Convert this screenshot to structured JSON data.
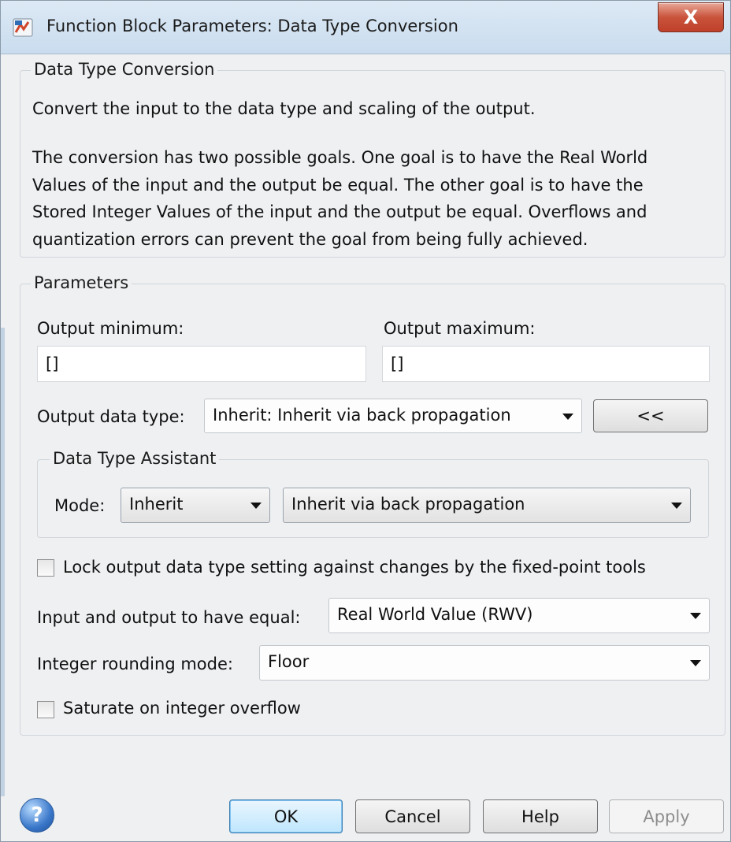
{
  "window": {
    "title": "Function Block Parameters: Data Type Conversion",
    "close_label": "X"
  },
  "description": {
    "group_label": "Data Type Conversion",
    "line1": "Convert the input to the data type and scaling of the output.",
    "para2_line1": "The conversion has two possible goals. One goal is to have the Real World",
    "para2_line2": "Values of the input and the output be equal.  The other goal is to have the",
    "para2_line3": "Stored Integer Values of the input and the output be equal.  Overflows and",
    "para2_line4": "quantization errors can prevent the goal from being fully achieved."
  },
  "parameters": {
    "group_label": "Parameters",
    "output_minimum": {
      "label": "Output minimum:",
      "value": "[]"
    },
    "output_maximum": {
      "label": "Output maximum:",
      "value": "[]"
    },
    "output_data_type": {
      "label": "Output data type:",
      "value": "Inherit: Inherit via back propagation",
      "toggle_label": "<<"
    },
    "assistant": {
      "group_label": "Data Type Assistant",
      "mode_label": "Mode:",
      "mode_value": "Inherit",
      "inherit_value": "Inherit via back propagation"
    },
    "lock_checkbox": {
      "label": "Lock output data type setting against changes by the fixed-point tools",
      "checked": false
    },
    "equal": {
      "label": "Input and output to have equal:",
      "value": "Real World Value (RWV)"
    },
    "rounding": {
      "label": "Integer rounding mode:",
      "value": "Floor"
    },
    "saturate_checkbox": {
      "label": "Saturate on integer overflow",
      "checked": false
    }
  },
  "buttons": {
    "help_icon": "?",
    "ok": "OK",
    "cancel": "Cancel",
    "help": "Help",
    "apply": "Apply"
  },
  "icons": {
    "app": "simulink-block-icon",
    "help": "help-question-icon"
  }
}
